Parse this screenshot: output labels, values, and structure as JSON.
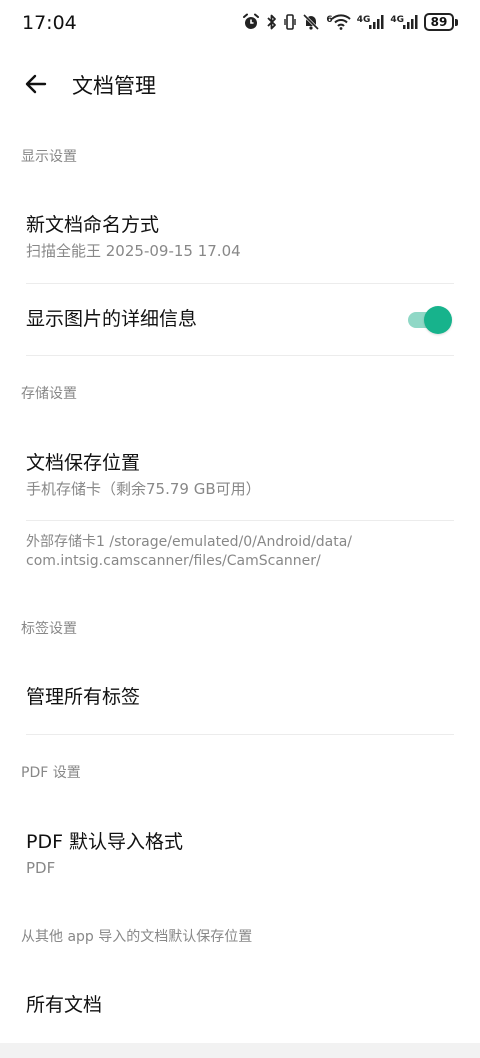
{
  "status_bar": {
    "time": "17:04",
    "network_labels": [
      "4G",
      "4G"
    ],
    "wifi_superscript": "6",
    "battery": "89",
    "icons": [
      "alarm-icon",
      "bluetooth-icon",
      "vibrate-icon",
      "mute-icon",
      "wifi-icon",
      "signal-icon",
      "signal-icon",
      "battery-icon"
    ]
  },
  "app_bar": {
    "back_icon": "back-arrow-icon",
    "title": "文档管理"
  },
  "sections": {
    "display": {
      "header": "显示设置",
      "naming_title": "新文档命名方式",
      "naming_value": "扫描全能王 2025-09-15 17.04",
      "details_title": "显示图片的详细信息",
      "details_toggle_on": true
    },
    "storage": {
      "header": "存储设置",
      "location_title": "文档保存位置",
      "location_value": "手机存储卡（剩余75.79 GB可用）",
      "path_line1": "外部存储卡1 /storage/emulated/0/Android/data/",
      "path_line2": "com.intsig.camscanner/files/CamScanner/"
    },
    "tags": {
      "header": "标签设置",
      "manage_title": "管理所有标签"
    },
    "pdf": {
      "header": "PDF 设置",
      "import_title": "PDF 默认导入格式",
      "import_value": "PDF"
    },
    "import_location": {
      "header": "从其他 app 导入的文档默认保存位置",
      "all_docs_title": "所有文档"
    }
  },
  "colors": {
    "accent": "#17b38c",
    "accent_track": "#8fd8c6",
    "secondary_text": "#888888",
    "divider": "#ececec"
  }
}
